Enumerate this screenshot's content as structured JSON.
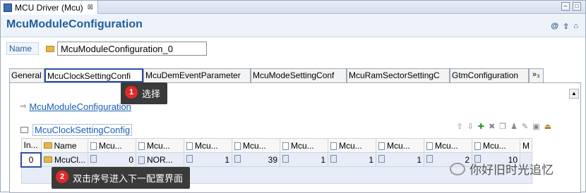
{
  "window": {
    "tab_title": "MCU Driver (Mcu)",
    "close_glyph": "⊠"
  },
  "header": {
    "title": "McuModuleConfiguration"
  },
  "name_field": {
    "label": "Name",
    "value": "McuModuleConfiguration_0"
  },
  "tabs": [
    {
      "label": "General"
    },
    {
      "label": "McuClockSettingConfi"
    },
    {
      "label": "McuDemEventParameter"
    },
    {
      "label": "McuModeSettingConf"
    },
    {
      "label": "McuRamSectorSettingC"
    },
    {
      "label": "GtmConfiguration"
    },
    {
      "label": "»₃"
    }
  ],
  "breadcrumb_link": "McuModuleConfiguration",
  "section": {
    "title": "McuClockSettingConfig"
  },
  "table": {
    "headers": [
      "In...",
      "Name",
      "Mcu...",
      "Mcu...",
      "Mcu...",
      "Mcu...",
      "Mcu...",
      "Mcu...",
      "Mcu...",
      "Mcu...",
      "Mcu...",
      "M"
    ],
    "row": [
      "0",
      "McuCl...",
      "0",
      "NOR...",
      "1",
      "39",
      "1",
      "1",
      "1",
      "2",
      "10",
      ""
    ]
  },
  "callouts": {
    "one": {
      "n": "1",
      "text": "选择"
    },
    "two": {
      "n": "2",
      "text": "双击序号进入下一配置界面"
    }
  },
  "watermark": "你好旧时光追忆"
}
